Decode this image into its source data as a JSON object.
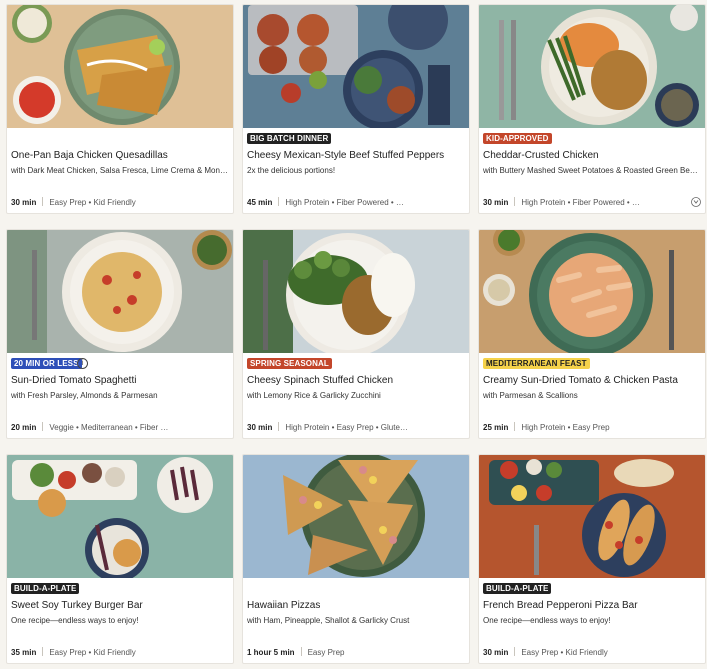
{
  "recipes": [
    {
      "title": "One-Pan Baja Chicken Quesadillas",
      "subtitle": "with Dark Meat Chicken, Salsa Fresca, Lime Crema & Monterey Jack",
      "tag": "",
      "time": "30 min",
      "attrs": "Easy Prep • Kid Friendly"
    },
    {
      "title": "Cheesy Mexican-Style Beef Stuffed Peppers",
      "subtitle": "2x the delicious portions!",
      "tag": "BIG BATCH DINNER",
      "time": "45 min",
      "attrs": "High Protein • Fiber Powered • …"
    },
    {
      "title": "Cheddar-Crusted Chicken",
      "subtitle": "with Buttery Mashed Sweet Potatoes & Roasted Green Beans",
      "tag": "KID-APPROVED",
      "time": "30 min",
      "attrs": "High Protein • Fiber Powered • …"
    },
    {
      "title": "Sun-Dried Tomato Spaghetti",
      "subtitle": "with Fresh Parsley, Almonds & Parmesan",
      "tag": "20 MIN OR LESS",
      "time": "20 min",
      "attrs": "Veggie • Mediterranean • Fiber …"
    },
    {
      "title": "Cheesy Spinach Stuffed Chicken",
      "subtitle": "with Lemony Rice & Garlicky Zucchini",
      "tag": "SPRING SEASONAL",
      "time": "30 min",
      "attrs": "High Protein • Easy Prep • Glute…"
    },
    {
      "title": "Creamy Sun-Dried Tomato & Chicken Pasta",
      "subtitle": "with Parmesan & Scallions",
      "tag": "MEDITERRANEAN FEAST",
      "time": "25 min",
      "attrs": "High Protein • Easy Prep"
    },
    {
      "title": "Sweet Soy Turkey Burger Bar",
      "subtitle": "One recipe—endless ways to enjoy!",
      "tag": "BUILD-A-PLATE",
      "time": "35 min",
      "attrs": "Easy Prep • Kid Friendly"
    },
    {
      "title": "Hawaiian Pizzas",
      "subtitle": "with Ham, Pineapple, Shallot & Garlicky Crust",
      "tag": "",
      "time": "1 hour 5 min",
      "attrs": "Easy Prep"
    },
    {
      "title": "French Bread Pepperoni Pizza Bar",
      "subtitle": "One recipe—endless ways to enjoy!",
      "tag": "BUILD-A-PLATE",
      "time": "30 min",
      "attrs": "Easy Prep • Kid Friendly"
    }
  ],
  "icons": {
    "info": "info-icon",
    "more": "more-options-icon"
  },
  "colors": {
    "tag_dark": "#222222",
    "tag_red": "#c3462a",
    "tag_blue": "#2e4fb8",
    "tag_yellow": "#f5d24a"
  }
}
